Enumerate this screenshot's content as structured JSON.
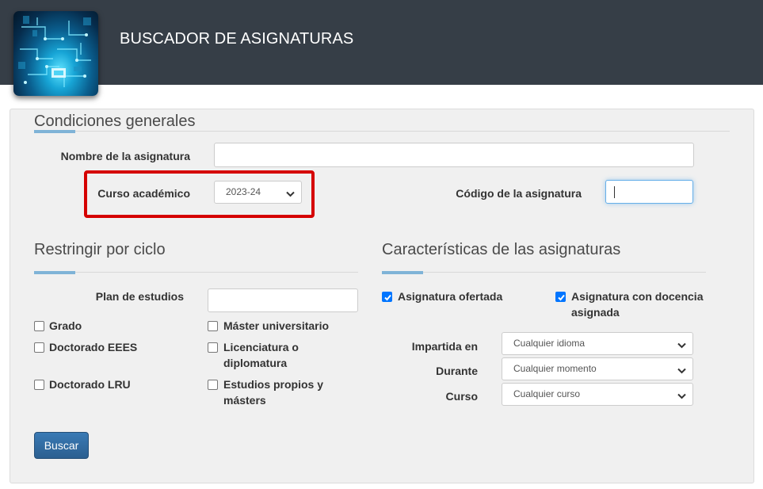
{
  "header": {
    "title": "BUSCADOR DE ASIGNATURAS",
    "background_color": "#363e47",
    "logo_icon": "circuit-board-logo"
  },
  "general": {
    "title": "Condiciones generales",
    "subject_name_label": "Nombre de la asignatura",
    "subject_name_value": "",
    "academic_year_label": "Curso académico",
    "academic_year_value": "2023-24",
    "subject_code_label": "Código de la asignatura",
    "subject_code_value": ""
  },
  "cycle": {
    "title": "Restringir por ciclo",
    "study_plan_label": "Plan de estudios",
    "study_plan_value": "",
    "options": {
      "grado": {
        "label": "Grado",
        "checked": false
      },
      "master": {
        "label": "Máster universitario",
        "checked": false
      },
      "doctorado_eees": {
        "label": "Doctorado EEES",
        "checked": false
      },
      "licenciatura": {
        "label": "Licenciatura o diplomatura",
        "checked": false
      },
      "doctorado_lru": {
        "label": "Doctorado LRU",
        "checked": false
      },
      "propios": {
        "label": "Estudios propios y másters",
        "checked": false
      }
    }
  },
  "features": {
    "title": "Características de las asignaturas",
    "offered": {
      "label": "Asignatura ofertada",
      "checked": true
    },
    "teaching": {
      "label": "Asignatura con docencia asignada",
      "checked": true
    },
    "language_label": "Impartida en",
    "language_value": "Cualquier idioma",
    "period_label": "Durante",
    "period_value": "Cualquier momento",
    "course_label": "Curso",
    "course_value": "Cualquier curso"
  },
  "search_button": "Buscar",
  "colors": {
    "accent_rule": "#7fb3d7",
    "highlight": "#d50000",
    "checkbox_checked": "#0075ff",
    "button": "#2f6aa0"
  }
}
